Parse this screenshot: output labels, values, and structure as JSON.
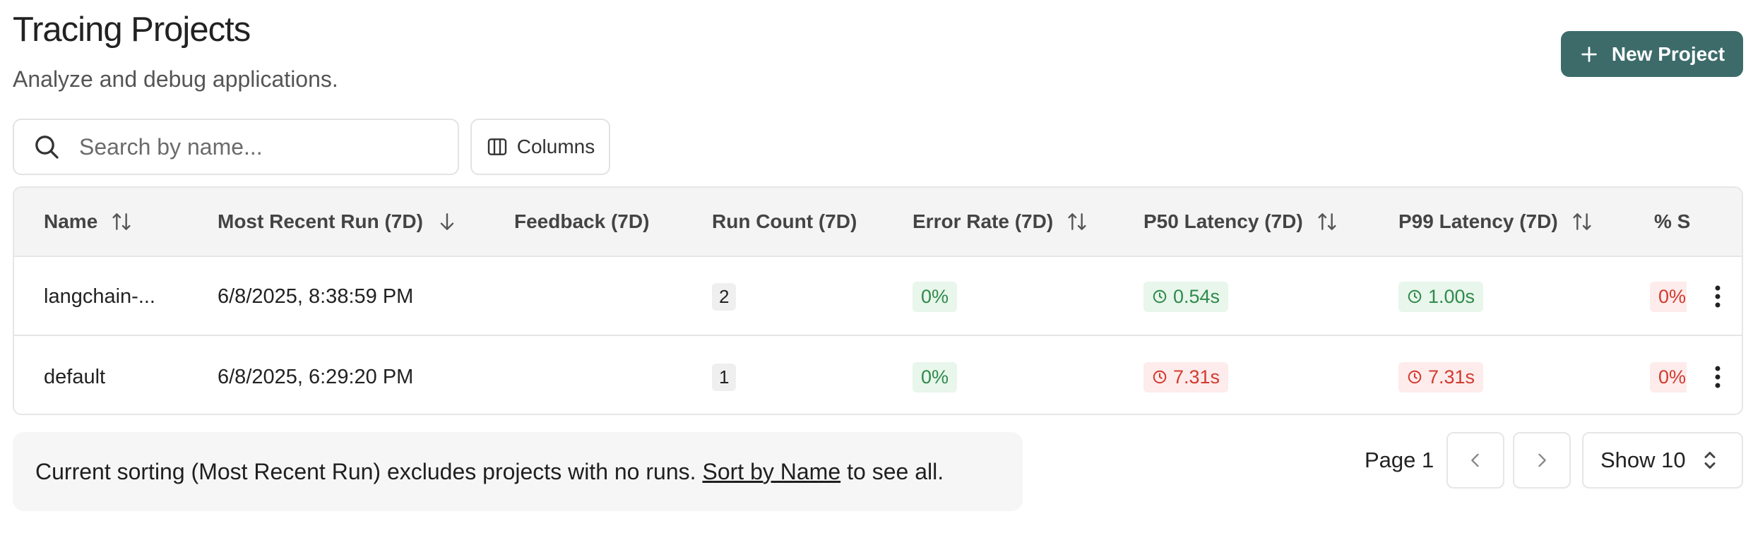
{
  "header": {
    "title": "Tracing Projects",
    "subtitle": "Analyze and debug applications.",
    "new_project_label": "New Project"
  },
  "toolbar": {
    "search_placeholder": "Search by name...",
    "search_value": "",
    "columns_label": "Columns"
  },
  "table": {
    "columns": [
      {
        "label": "Name",
        "sort": "both"
      },
      {
        "label": "Most Recent Run (7D)",
        "sort": "desc"
      },
      {
        "label": "Feedback (7D)",
        "sort": "none"
      },
      {
        "label": "Run Count (7D)",
        "sort": "none"
      },
      {
        "label": "Error Rate (7D)",
        "sort": "both"
      },
      {
        "label": "P50 Latency (7D)",
        "sort": "both"
      },
      {
        "label": "P99 Latency (7D)",
        "sort": "both"
      },
      {
        "label": "% S",
        "sort": "none"
      }
    ],
    "rows": [
      {
        "name": "langchain-...",
        "most_recent_run": "6/8/2025, 8:38:59 PM",
        "feedback": "",
        "run_count": "2",
        "error_rate": "0%",
        "p50_latency": "0.54s",
        "p50_status": "green",
        "p99_latency": "1.00s",
        "p99_status": "green",
        "percent_s": "0%"
      },
      {
        "name": "default",
        "most_recent_run": "6/8/2025, 6:29:20 PM",
        "feedback": "",
        "run_count": "1",
        "error_rate": "0%",
        "p50_latency": "7.31s",
        "p50_status": "red",
        "p99_latency": "7.31s",
        "p99_status": "red",
        "percent_s": "0%"
      }
    ]
  },
  "notice": {
    "before": "Current sorting (Most Recent Run) excludes projects with no runs.",
    "link": "Sort by Name",
    "after": "to see all."
  },
  "pagination": {
    "page_label": "Page 1",
    "show_label": "Show 10"
  },
  "colors": {
    "accent": "#3c6b6a",
    "good": "#2f8a4a",
    "bad": "#d23a2f"
  }
}
